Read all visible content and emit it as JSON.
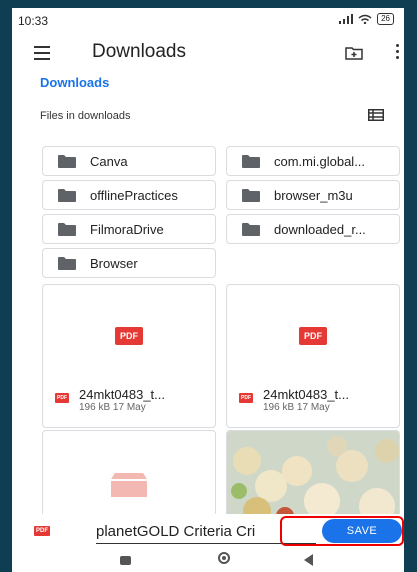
{
  "status": {
    "time": "10:33",
    "battery": "26"
  },
  "appbar": {
    "title": "Downloads"
  },
  "breadcrumb": "Downloads",
  "section_label": "Files in downloads",
  "folders": [
    "Canva",
    "com.mi.global...",
    "offlinePractices",
    "browser_m3u",
    "FilmoraDrive",
    "downloaded_r...",
    "Browser"
  ],
  "files": [
    {
      "badge": "PDF",
      "name": "24mkt0483_t...",
      "meta": "196 kB 17 May"
    },
    {
      "badge": "PDF",
      "name": "24mkt0483_t...",
      "meta": "196 kB 17 May"
    }
  ],
  "save_bar": {
    "badge": "PDF",
    "filename": "planetGOLD Criteria Cri",
    "save_label": "SAVE"
  },
  "colors": {
    "accent": "#1a73e8",
    "pdf": "#e53935",
    "highlight": "#e00000"
  }
}
